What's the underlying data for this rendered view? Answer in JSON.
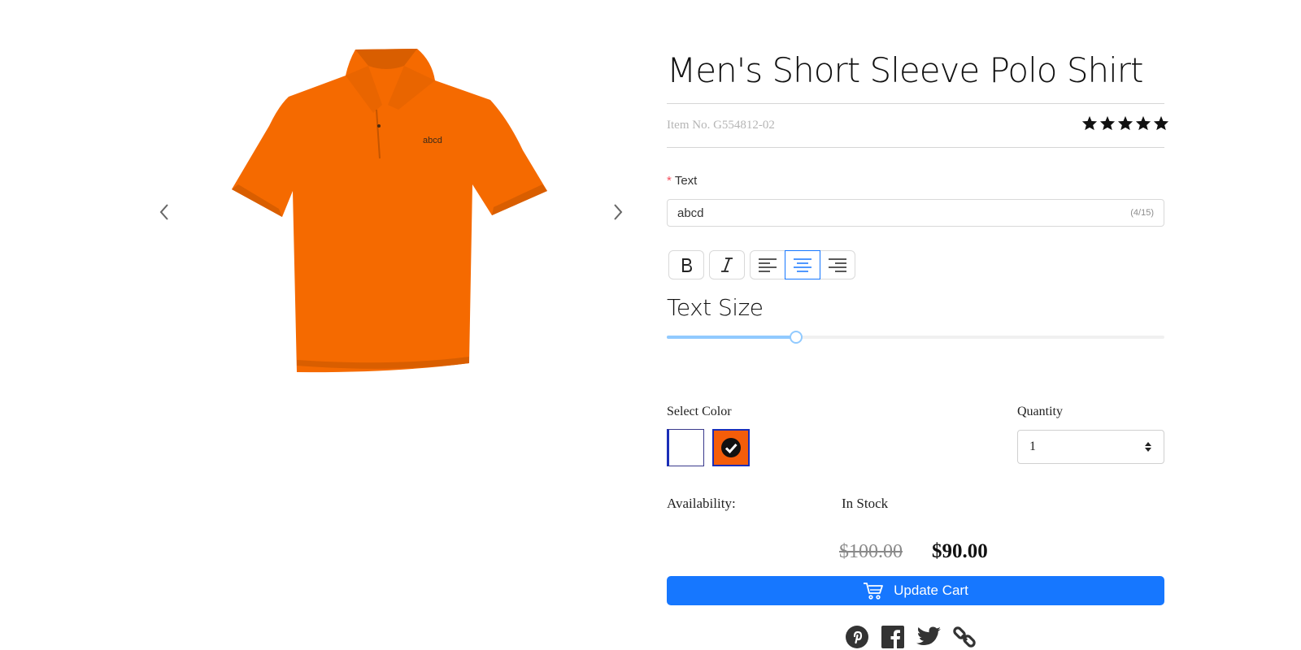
{
  "product": {
    "title": "Men's Short Sleeve Polo Shirt",
    "item_no": "Item No. G554812-02",
    "rating_stars": 5,
    "preview_text": "abcd",
    "shirt_color": "#f56a00"
  },
  "text_field": {
    "required_mark": "*",
    "label": "Text",
    "value": "abcd",
    "counter": "(4/15)"
  },
  "toolbar": {
    "bold_icon": "bold-icon",
    "italic_icon": "italic-icon",
    "align_left_icon": "align-left-icon",
    "align_center_icon": "align-center-icon",
    "align_right_icon": "align-right-icon",
    "active_alignment": "center",
    "accent_color": "#1677ff"
  },
  "text_size": {
    "title": "Text Size",
    "value_fraction": 0.26
  },
  "color": {
    "label": "Select Color",
    "options": [
      "#ffffff",
      "#f45d0a"
    ],
    "selected": "#f45d0a"
  },
  "quantity": {
    "label": "Quantity",
    "value": "1"
  },
  "availability": {
    "label": "Availability:",
    "value": "In Stock"
  },
  "price": {
    "original": "$100.00",
    "current": "$90.00"
  },
  "cart": {
    "button_label": "Update Cart",
    "icon": "cart-icon",
    "color": "#1677ff"
  },
  "share": {
    "icons": [
      "pinterest-icon",
      "facebook-icon",
      "twitter-icon",
      "link-icon"
    ]
  }
}
